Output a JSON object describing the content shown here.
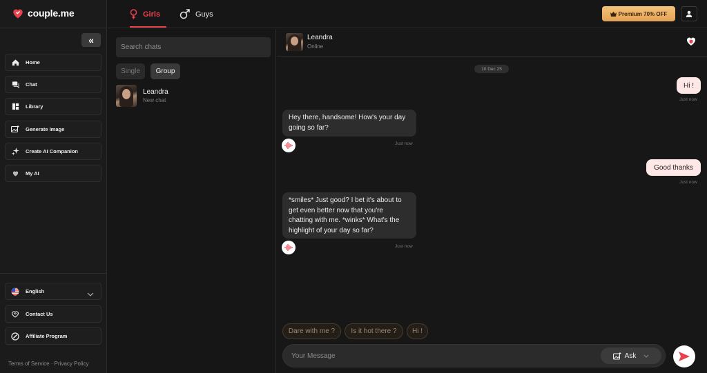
{
  "brand": {
    "name": "couple.me",
    "accent": "#e8424f"
  },
  "sidebar": {
    "collapse_icon": "double-chevron-left-icon",
    "items": [
      {
        "label": "Home",
        "icon": "home-icon"
      },
      {
        "label": "Chat",
        "icon": "chat-icon"
      },
      {
        "label": "Library",
        "icon": "library-icon"
      },
      {
        "label": "Generate Image",
        "icon": "image-icon"
      },
      {
        "label": "Create AI Companion",
        "icon": "sparkle-icon"
      },
      {
        "label": "My AI",
        "icon": "heart-icon"
      }
    ],
    "bottom_items": [
      {
        "label": "English",
        "icon": "us-flag-icon"
      },
      {
        "label": "Contact Us",
        "icon": "contact-icon"
      },
      {
        "label": "Affiliate Program",
        "icon": "affiliate-icon"
      }
    ],
    "footer": "Terms of Service · Privacy Policy"
  },
  "topbar": {
    "tabs": [
      {
        "label": "Girls",
        "icon": "female-symbol-icon",
        "active": true
      },
      {
        "label": "Guys",
        "icon": "male-symbol-icon",
        "active": false
      }
    ],
    "premium_label": "Premium 70% OFF"
  },
  "chatlist": {
    "search_placeholder": "Search chats",
    "filters": [
      "Single",
      "Group"
    ],
    "chats": [
      {
        "name": "Leandra",
        "subtitle": "New chat"
      }
    ]
  },
  "conversation": {
    "name": "Leandra",
    "status": "Online",
    "date": "10 Dec 25",
    "messages": [
      {
        "from": "user",
        "text": "Hi !",
        "time": "Just now"
      },
      {
        "from": "bot",
        "lines": [
          "Hey there, handsome! How's your day",
          "going so far?"
        ],
        "time": "Just now"
      },
      {
        "from": "user",
        "text": "Good thanks",
        "time": "Just now"
      },
      {
        "from": "bot",
        "lines": [
          "*smiles* Just good? I bet it's about to",
          "get even better now that you're",
          "chatting with me. *winks* What's the",
          "highlight of your day so far?"
        ],
        "time": "Just now"
      }
    ],
    "suggestions": [
      "Dare with me ?",
      "Is it hot there ?",
      "Hi !"
    ],
    "input_placeholder": "Your Message",
    "ask_label": "Ask"
  }
}
